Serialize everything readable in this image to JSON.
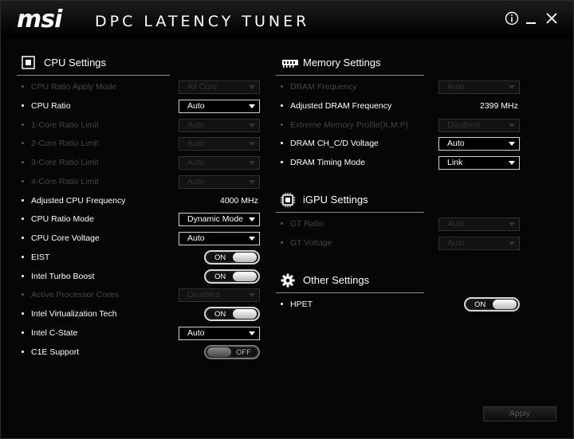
{
  "window": {
    "brand": "msi",
    "title": "DPC LATENCY TUNER"
  },
  "cpu": {
    "title": "CPU Settings",
    "rows": [
      {
        "label": "CPU Ratio Apply Mode",
        "kind": "dropdown",
        "value": "All Core",
        "enabled": false
      },
      {
        "label": "CPU Ratio",
        "kind": "dropdown",
        "value": "Auto",
        "enabled": true
      },
      {
        "label": "1-Core Ratio Limit",
        "kind": "dropdown",
        "value": "Auto",
        "enabled": false
      },
      {
        "label": "2-Core Ratio Limit",
        "kind": "dropdown",
        "value": "Auto",
        "enabled": false
      },
      {
        "label": "3-Core Ratio Limit",
        "kind": "dropdown",
        "value": "Auto",
        "enabled": false
      },
      {
        "label": "4-Core Ratio Limit",
        "kind": "dropdown",
        "value": "Auto",
        "enabled": false
      },
      {
        "label": "Adjusted CPU Frequency",
        "kind": "value",
        "value": "4000 MHz",
        "enabled": true
      },
      {
        "label": "CPU Ratio Mode",
        "kind": "dropdown",
        "value": "Dynamic Mode",
        "enabled": true
      },
      {
        "label": "CPU Core Voltage",
        "kind": "dropdown",
        "value": "Auto",
        "enabled": true
      },
      {
        "label": "EIST",
        "kind": "toggle",
        "value": "ON",
        "enabled": true
      },
      {
        "label": "Intel Turbo Boost",
        "kind": "toggle",
        "value": "ON",
        "enabled": true
      },
      {
        "label": "Active Processor Cores",
        "kind": "dropdown",
        "value": "Disabled",
        "enabled": false
      },
      {
        "label": "Intel Virtualization Tech",
        "kind": "toggle",
        "value": "ON",
        "enabled": true
      },
      {
        "label": "Intel C-State",
        "kind": "dropdown",
        "value": "Auto",
        "enabled": true
      },
      {
        "label": "C1E Support",
        "kind": "toggle",
        "value": "OFF",
        "enabled": true
      }
    ]
  },
  "memory": {
    "title": "Memory Settings",
    "rows": [
      {
        "label": "DRAM Frequency",
        "kind": "dropdown",
        "value": "Auto",
        "enabled": false
      },
      {
        "label": "Adjusted DRAM Frequency",
        "kind": "value",
        "value": "2399 MHz",
        "enabled": true
      },
      {
        "label": "Extreme Memory Profile(X.M.P)",
        "kind": "dropdown",
        "value": "Disabled",
        "enabled": false
      },
      {
        "label": "DRAM CH_C/D Voltage",
        "kind": "dropdown",
        "value": "Auto",
        "enabled": true
      },
      {
        "label": "DRAM Timing Mode",
        "kind": "dropdown",
        "value": "Link",
        "enabled": true
      }
    ]
  },
  "igpu": {
    "title": "iGPU Settings",
    "rows": [
      {
        "label": "GT Ratio",
        "kind": "dropdown",
        "value": "Auto",
        "enabled": false
      },
      {
        "label": "GT Voltage",
        "kind": "dropdown",
        "value": "Auto",
        "enabled": false
      }
    ]
  },
  "other": {
    "title": "Other Settings",
    "rows": [
      {
        "label": "HPET",
        "kind": "toggle",
        "value": "ON",
        "enabled": true
      }
    ]
  },
  "apply_label": "Apply"
}
